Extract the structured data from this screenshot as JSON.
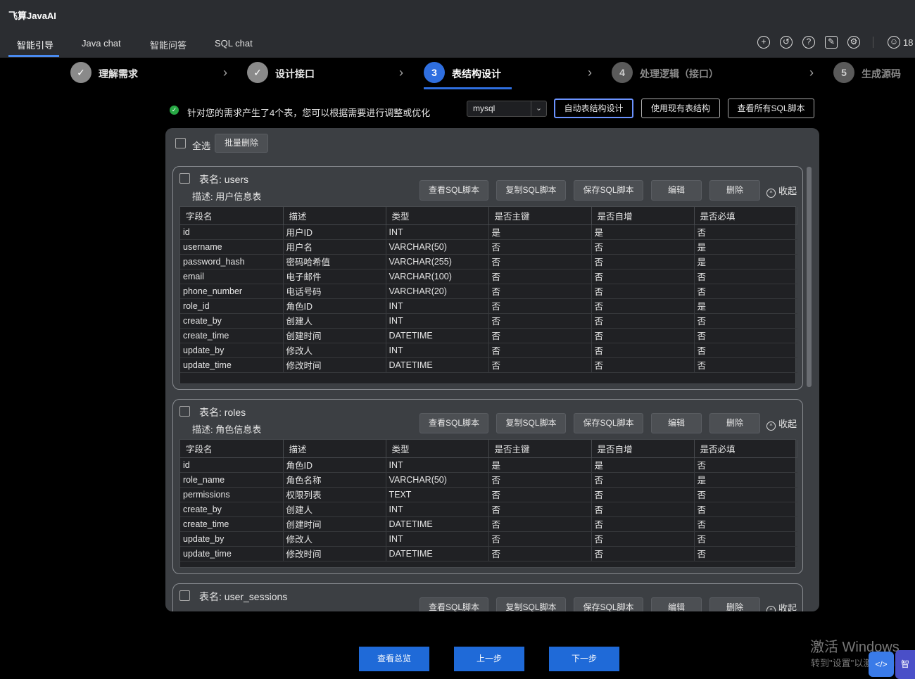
{
  "app": {
    "title": "飞算JavaAI"
  },
  "tabs": [
    {
      "label": "智能引导"
    },
    {
      "label": "Java chat"
    },
    {
      "label": "智能问答"
    },
    {
      "label": "SQL chat"
    }
  ],
  "header": {
    "user_label": "18"
  },
  "steps": [
    {
      "number": "✓",
      "label": "理解需求",
      "state": "done"
    },
    {
      "number": "✓",
      "label": "设计接口",
      "state": "done"
    },
    {
      "number": "3",
      "label": "表结构设计",
      "state": "active"
    },
    {
      "number": "4",
      "label": "处理逻辑（接口）",
      "state": "todo"
    },
    {
      "number": "5",
      "label": "生成源码",
      "state": "todo"
    }
  ],
  "toolbar": {
    "status_text": "针对您的需求产生了4个表，您可以根据需要进行调整或优化",
    "db_type": "mysql",
    "auto_design": "自动表结构设计",
    "use_existing": "使用现有表结构",
    "view_all_sql": "查看所有SQL脚本"
  },
  "panel": {
    "select_all": "全选",
    "batch_delete": "批量删除"
  },
  "card_actions": {
    "view_sql": "查看SQL脚本",
    "copy_sql": "复制SQL脚本",
    "save_sql": "保存SQL脚本",
    "edit": "编辑",
    "delete": "删除",
    "collapse": "收起"
  },
  "columns": [
    "字段名",
    "描述",
    "类型",
    "是否主键",
    "是否自增",
    "是否必填"
  ],
  "tables": [
    {
      "title": "表名: users",
      "desc": "描述: 用户信息表",
      "rows": [
        [
          "id",
          "用户ID",
          "INT",
          "是",
          "是",
          "否"
        ],
        [
          "username",
          "用户名",
          "VARCHAR(50)",
          "否",
          "否",
          "是"
        ],
        [
          "password_hash",
          "密码哈希值",
          "VARCHAR(255)",
          "否",
          "否",
          "是"
        ],
        [
          "email",
          "电子邮件",
          "VARCHAR(100)",
          "否",
          "否",
          "否"
        ],
        [
          "phone_number",
          "电话号码",
          "VARCHAR(20)",
          "否",
          "否",
          "否"
        ],
        [
          "role_id",
          "角色ID",
          "INT",
          "否",
          "否",
          "是"
        ],
        [
          "create_by",
          "创建人",
          "INT",
          "否",
          "否",
          "否"
        ],
        [
          "create_time",
          "创建时间",
          "DATETIME",
          "否",
          "否",
          "否"
        ],
        [
          "update_by",
          "修改人",
          "INT",
          "否",
          "否",
          "否"
        ],
        [
          "update_time",
          "修改时间",
          "DATETIME",
          "否",
          "否",
          "否"
        ]
      ]
    },
    {
      "title": "表名: roles",
      "desc": "描述: 角色信息表",
      "rows": [
        [
          "id",
          "角色ID",
          "INT",
          "是",
          "是",
          "否"
        ],
        [
          "role_name",
          "角色名称",
          "VARCHAR(50)",
          "否",
          "否",
          "是"
        ],
        [
          "permissions",
          "权限列表",
          "TEXT",
          "否",
          "否",
          "否"
        ],
        [
          "create_by",
          "创建人",
          "INT",
          "否",
          "否",
          "否"
        ],
        [
          "create_time",
          "创建时间",
          "DATETIME",
          "否",
          "否",
          "否"
        ],
        [
          "update_by",
          "修改人",
          "INT",
          "否",
          "否",
          "否"
        ],
        [
          "update_time",
          "修改时间",
          "DATETIME",
          "否",
          "否",
          "否"
        ]
      ]
    },
    {
      "title": "表名: user_sessions"
    }
  ],
  "footer": {
    "overview": "查看总览",
    "prev": "上一步",
    "next": "下一步"
  },
  "watermark": {
    "line1": "激活 Windows",
    "line2": "转到\"设置\"以激活 Win"
  },
  "floating": {
    "code_icon": "</>",
    "tag": "智"
  }
}
